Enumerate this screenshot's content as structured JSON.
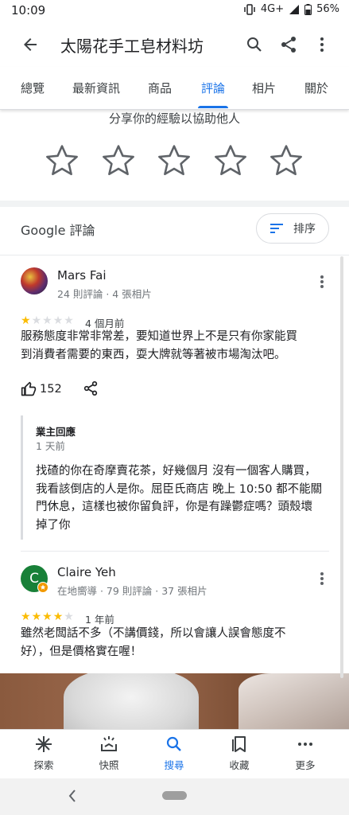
{
  "status_bar": {
    "time": "10:09",
    "network": "4G+",
    "battery": "56%"
  },
  "app_bar": {
    "title": "太陽花手工皂材料坊"
  },
  "tabs": [
    {
      "label": "總覽"
    },
    {
      "label": "最新資訊"
    },
    {
      "label": "商品"
    },
    {
      "label": "評論",
      "active": true
    },
    {
      "label": "相片"
    },
    {
      "label": "關於"
    }
  ],
  "rate_prompt": "分享你的經驗以協助他人",
  "reviews_header": {
    "title": "Google 評論",
    "sort_label": "排序"
  },
  "reviews": [
    {
      "name": "Mars Fai",
      "meta": "24 則評論 · 4 張相片",
      "rating": 1,
      "time_ago": "4 個月前",
      "text_lines": [
        "服務態度非常非常差，要知道世界上不是只有你家能買",
        "到消費者需要的東西，耍大牌就等著被市場淘汰吧。"
      ],
      "likes": "152",
      "owner_reply": {
        "header": "業主回應",
        "time": "1 天前",
        "text_lines": [
          "找碴的你在奇摩賣花茶，好幾個月 沒有一個客人購買，",
          "我看該倒店的人是你。屈臣氏商店 晚上 10:50 都不能關",
          "門休息，這樣也被你留負評，你是有躁鬱症嗎？頭殼壞",
          "掉了你"
        ]
      }
    },
    {
      "name": "Claire Yeh",
      "avatar_letter": "C",
      "meta": "在地嚮導 · 79 則評論 · 37 張相片",
      "rating": 4,
      "time_ago": "1 年前",
      "text_lines": [
        "雖然老闆話不多（不講價錢，所以會讓人誤會態度不",
        "好），但是價格實在喔！"
      ]
    }
  ],
  "bottom_nav": [
    {
      "label": "探索",
      "icon": "explore-icon"
    },
    {
      "label": "快照",
      "icon": "snapshot-icon"
    },
    {
      "label": "搜尋",
      "icon": "search-icon",
      "active": true
    },
    {
      "label": "收藏",
      "icon": "bookmark-icon"
    },
    {
      "label": "更多",
      "icon": "more-horiz-icon"
    }
  ],
  "colors": {
    "accent": "#1a73e8",
    "star": "#fbbc04",
    "star_empty": "#dadce0",
    "avatar_green": "#188038",
    "local_guide_badge": "#f29900"
  }
}
